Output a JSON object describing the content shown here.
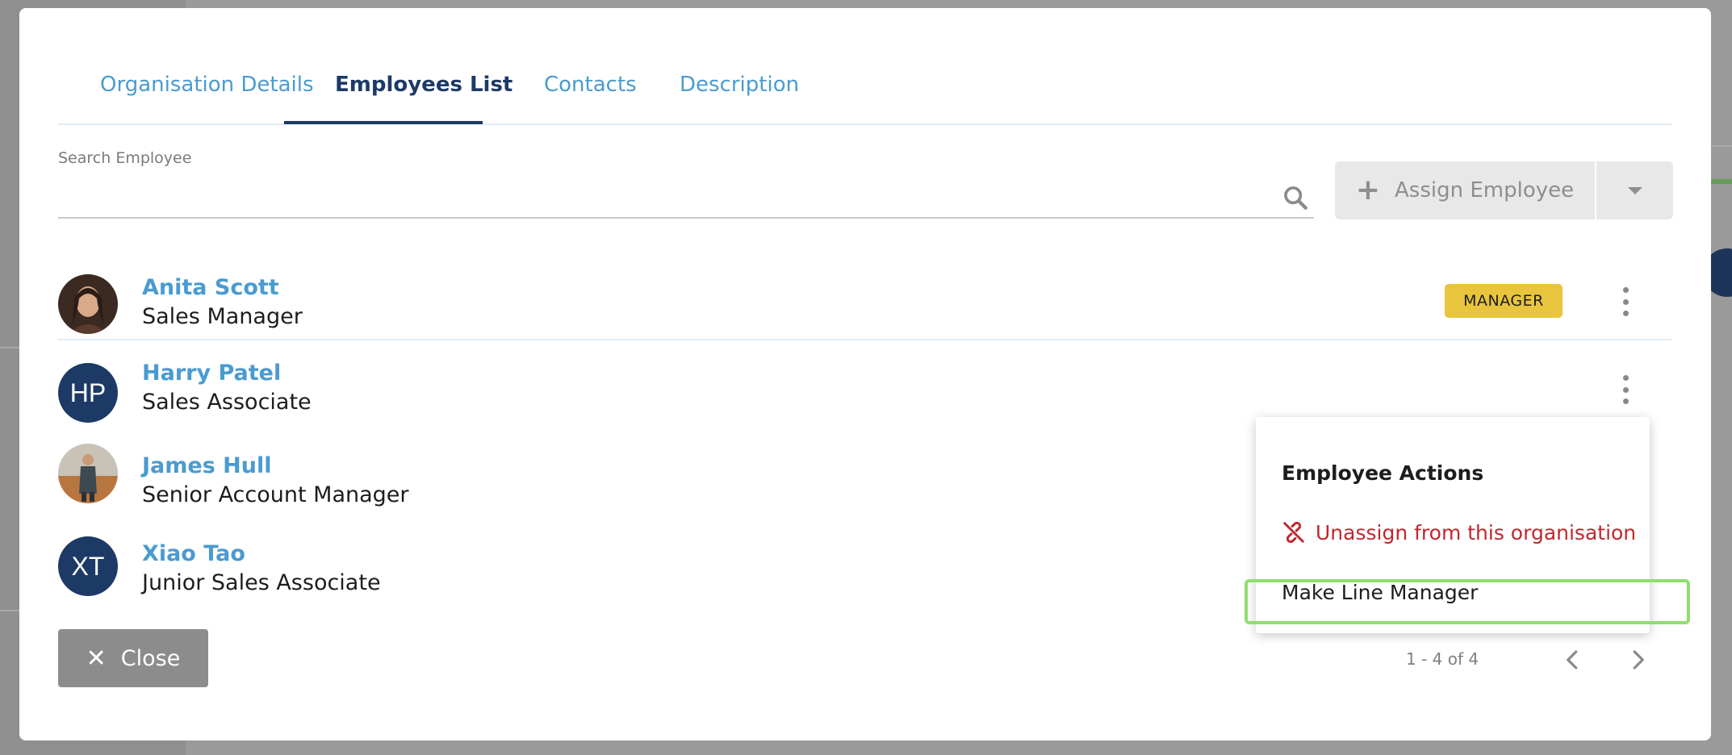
{
  "colors": {
    "accent": "#4a9bd0",
    "active_tab": "#1d3a66",
    "badge": "#e9c53d",
    "danger": "#c0282e",
    "highlight": "#8fde6e"
  },
  "tabs": [
    {
      "label": "Organisation Details",
      "active": false
    },
    {
      "label": "Employees List",
      "active": true
    },
    {
      "label": "Contacts",
      "active": false
    },
    {
      "label": "Description",
      "active": false
    }
  ],
  "search": {
    "label": "Search Employee",
    "value": "",
    "placeholder": "",
    "icon": "search-icon"
  },
  "assign": {
    "label": "Assign Employee",
    "icon": "plus-icon",
    "caret_icon": "caret-down-icon"
  },
  "employees": [
    {
      "name": "Anita Scott",
      "role": "Sales Manager",
      "badge": "MANAGER",
      "avatar": "photo"
    },
    {
      "name": "Harry Patel",
      "role": "Sales Associate",
      "initials": "HP"
    },
    {
      "name": "James Hull",
      "role": "Senior Account Manager",
      "avatar": "photo"
    },
    {
      "name": "Xiao Tao",
      "role": "Junior Sales Associate",
      "initials": "XT"
    }
  ],
  "close_button": {
    "label": "Close",
    "icon": "close-icon"
  },
  "pagination": {
    "text": "1 - 4 of 4"
  },
  "menu": {
    "title": "Employee Actions",
    "items": [
      {
        "label": "Unassign from this organisation",
        "icon": "unlink-icon"
      },
      {
        "label": "Make Line Manager"
      }
    ]
  }
}
